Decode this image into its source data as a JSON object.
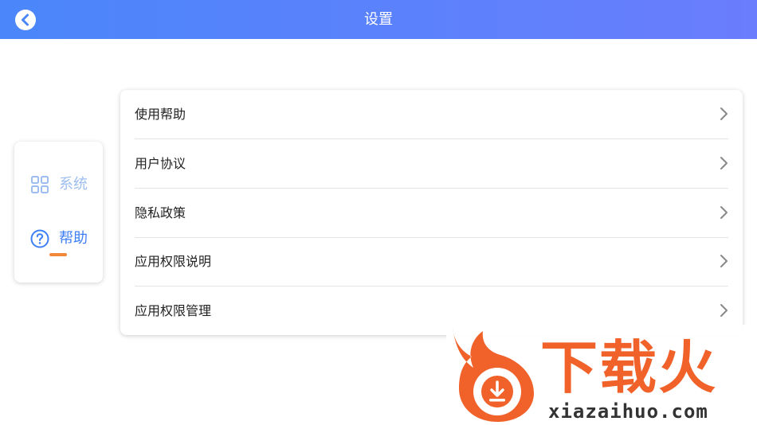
{
  "header": {
    "title": "设置",
    "back_icon": "back-arrow-icon"
  },
  "sidebar": {
    "items": [
      {
        "label": "系统",
        "icon": "grid-icon",
        "active": false
      },
      {
        "label": "帮助",
        "icon": "question-circle-icon",
        "active": true
      }
    ],
    "indicator_color": "#f3873a"
  },
  "menu": {
    "items": [
      {
        "label": "使用帮助"
      },
      {
        "label": "用户协议"
      },
      {
        "label": "隐私政策"
      },
      {
        "label": "应用权限说明"
      },
      {
        "label": "应用权限管理"
      }
    ]
  },
  "watermark": {
    "text_cn": "下载火",
    "url": "xiazaihuo.com"
  },
  "colors": {
    "accent": "#3f7ff5",
    "header_start": "#4b86fb",
    "header_end": "#6a7dfc",
    "watermark": "#f1612a"
  }
}
